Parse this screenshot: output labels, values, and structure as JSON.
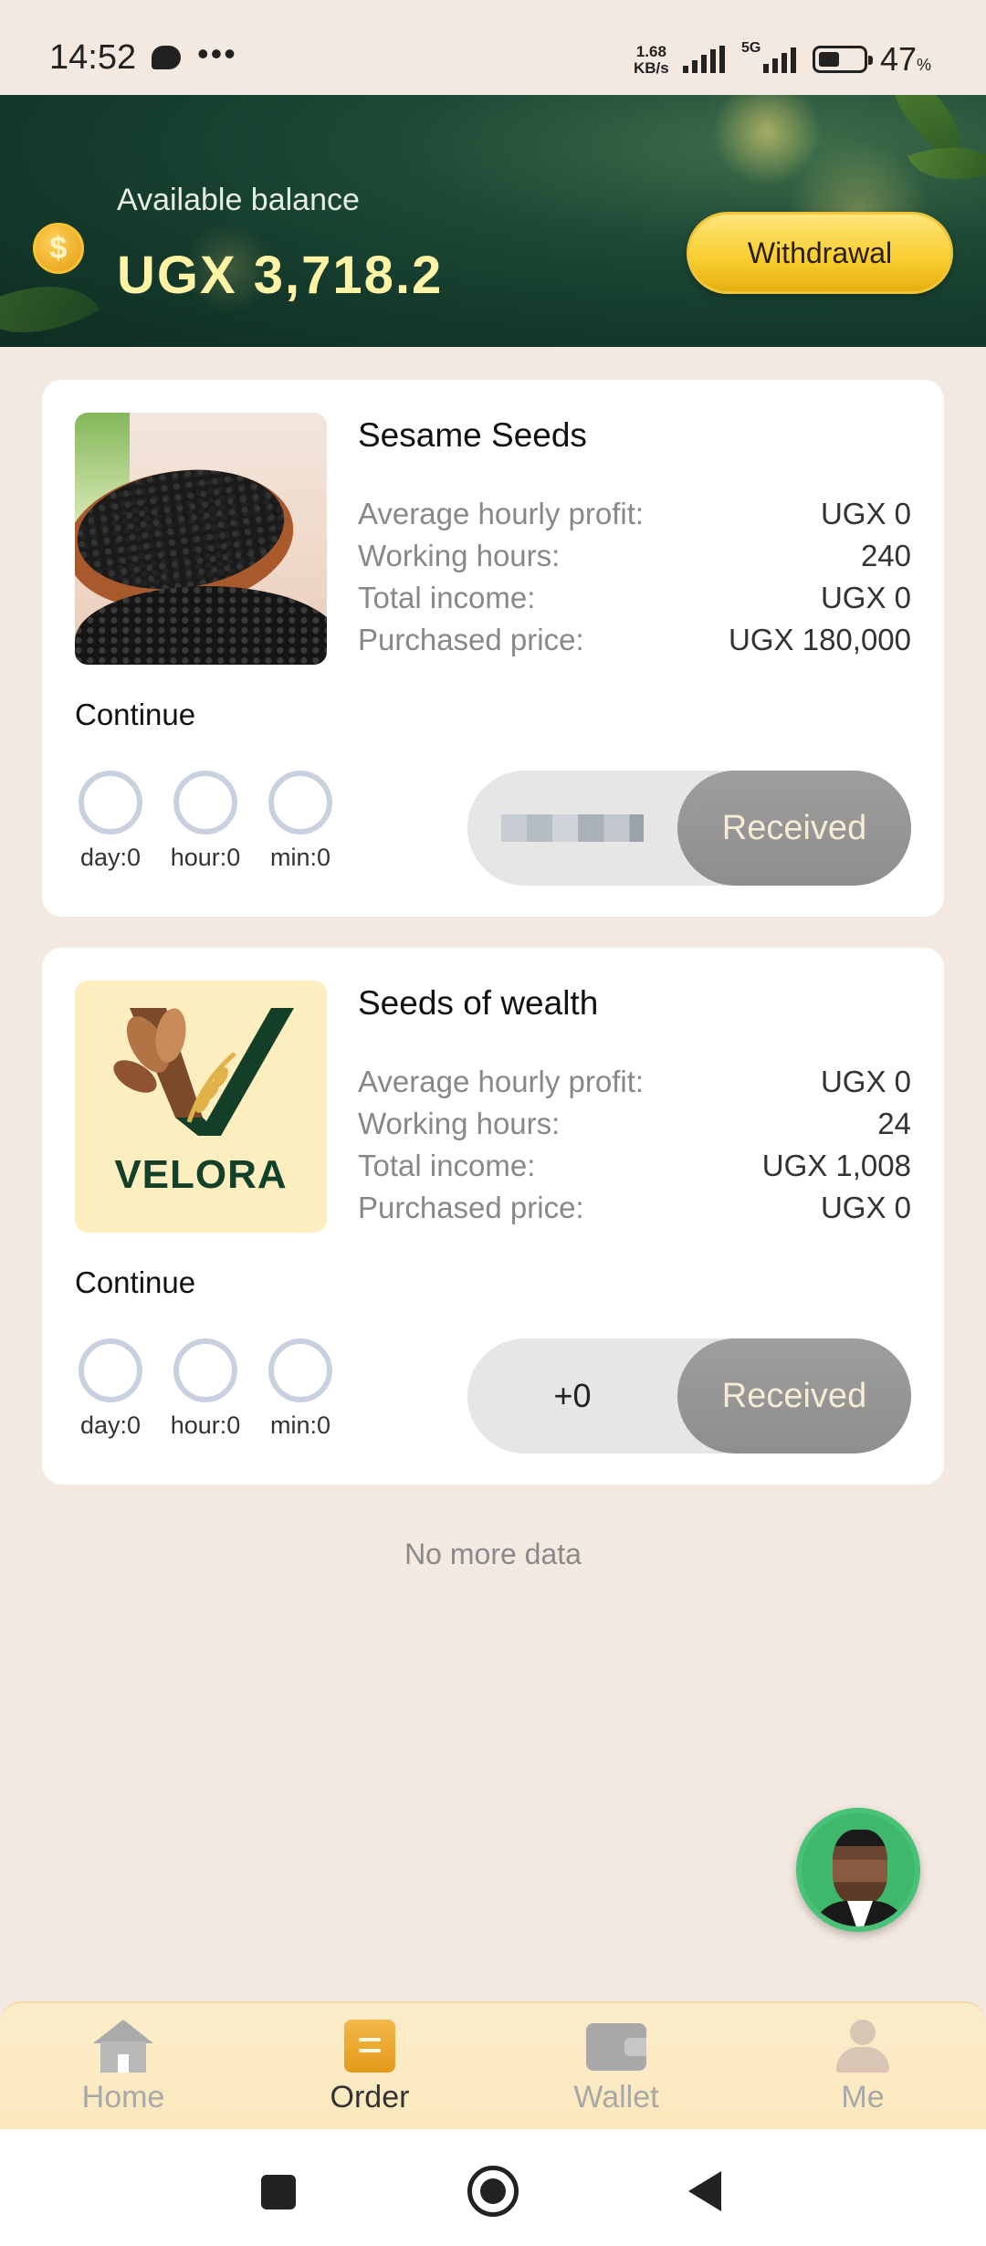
{
  "status_bar": {
    "time": "14:52",
    "speed_value": "1.68",
    "speed_unit": "KB/s",
    "network": "5G",
    "battery_percent": "47",
    "battery_unit": "%"
  },
  "header": {
    "balance_label": "Available balance",
    "balance_value": "UGX 3,718.2",
    "withdraw_label": "Withdrawal",
    "coin_symbol": "$"
  },
  "cards": [
    {
      "title": "Sesame Seeds",
      "rows": [
        {
          "label": "Average hourly profit:",
          "value": "UGX 0"
        },
        {
          "label": "Working hours:",
          "value": "240"
        },
        {
          "label": "Total income:",
          "value": "UGX 0"
        },
        {
          "label": "Purchased price:",
          "value": "UGX 180,000"
        }
      ],
      "status": "Continue",
      "timers": {
        "day": "day:0",
        "hour": "hour:0",
        "min": "min:0"
      },
      "pill_value": "",
      "received_label": "Received"
    },
    {
      "title": "Seeds of wealth",
      "logo_text": "VELORA",
      "rows": [
        {
          "label": "Average hourly profit:",
          "value": "UGX 0"
        },
        {
          "label": "Working hours:",
          "value": "24"
        },
        {
          "label": "Total income:",
          "value": "UGX 1,008"
        },
        {
          "label": "Purchased price:",
          "value": "UGX 0"
        }
      ],
      "status": "Continue",
      "timers": {
        "day": "day:0",
        "hour": "hour:0",
        "min": "min:0"
      },
      "pill_value": "+0",
      "received_label": "Received"
    }
  ],
  "footer_text": "No more data",
  "bottom_nav": {
    "items": [
      {
        "label": "Home",
        "icon": "home-icon",
        "active": false
      },
      {
        "label": "Order",
        "icon": "order-icon",
        "active": true
      },
      {
        "label": "Wallet",
        "icon": "wallet-icon",
        "active": false
      },
      {
        "label": "Me",
        "icon": "person-icon",
        "active": false
      }
    ]
  },
  "colors": {
    "background": "#f4e9e1",
    "banner": "#1d4a36",
    "balance_text": "#fff3a6",
    "withdraw_button": "#f8cd2e",
    "received_button": "#9e9e9e",
    "nav_background": "#fbecc9"
  }
}
